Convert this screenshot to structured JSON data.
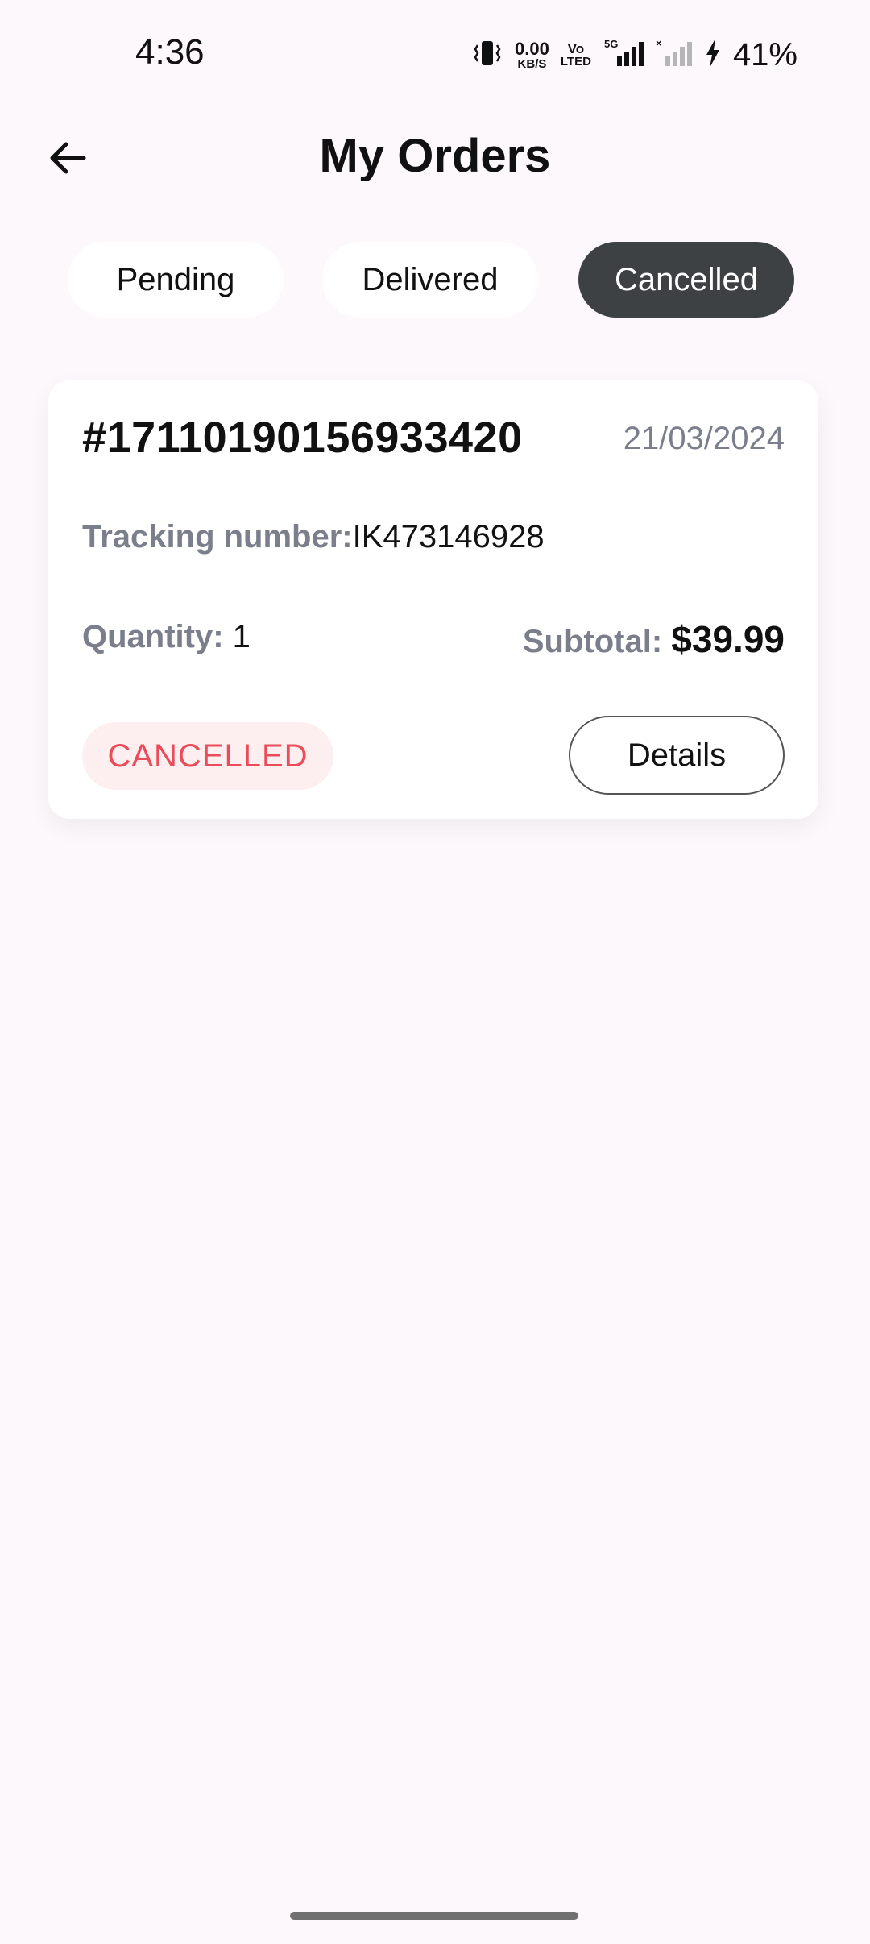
{
  "status_bar": {
    "time": "4:36",
    "net_rate_value": "0.00",
    "net_rate_unit": "KB/S",
    "volte_top": "Vo",
    "volte_bottom": "LTED",
    "network_type": "5G",
    "battery_percent": "41%",
    "icons": [
      "vibrate-icon",
      "signal-5g-icon",
      "signal-no-service-icon",
      "charging-icon"
    ]
  },
  "header": {
    "title": "My Orders",
    "back_icon": "arrow-left-icon"
  },
  "tabs": [
    {
      "label": "Pending",
      "active": false
    },
    {
      "label": "Delivered",
      "active": false
    },
    {
      "label": "Cancelled",
      "active": true
    }
  ],
  "order": {
    "id": "#17110190156933420",
    "date": "21/03/2024",
    "tracking_label": "Tracking number:",
    "tracking_value": "IK473146928",
    "quantity_label": "Quantity:",
    "quantity_value": "1",
    "subtotal_label": "Subtotal:",
    "subtotal_value": "$39.99",
    "status": "CANCELLED",
    "details_label": "Details"
  },
  "colors": {
    "background": "#fdf8fb",
    "active_tab": "#3d4144",
    "muted_text": "#7b7f8c",
    "cancelled_text": "#ea4c5a",
    "cancelled_badge_bg": "#fdeef0"
  }
}
